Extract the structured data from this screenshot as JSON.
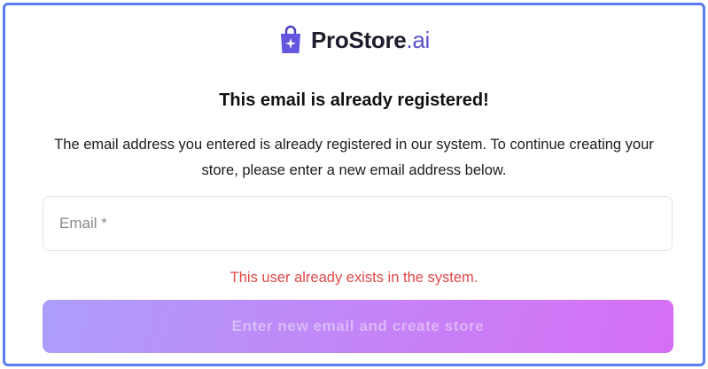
{
  "brand": {
    "name": "ProStore",
    "suffix": ".ai",
    "icon": "shopping-bag-sparkle-icon",
    "colors": {
      "primary": "#5a4fd0",
      "text": "#1d1d2c"
    }
  },
  "heading": "This email is already registered!",
  "description": "The email address you entered is already registered in our system. To continue creating your store, please enter a new email address below.",
  "email_field": {
    "placeholder": "Email *",
    "value": ""
  },
  "error_message": "This user already exists in the system.",
  "submit_button": {
    "label": "Enter new email and create store",
    "disabled": true
  },
  "colors": {
    "frame_border": "#5b7cf0",
    "error": "#e04848",
    "button_gradient_start": "#ad9dfb",
    "button_gradient_end": "#d66ef5"
  }
}
